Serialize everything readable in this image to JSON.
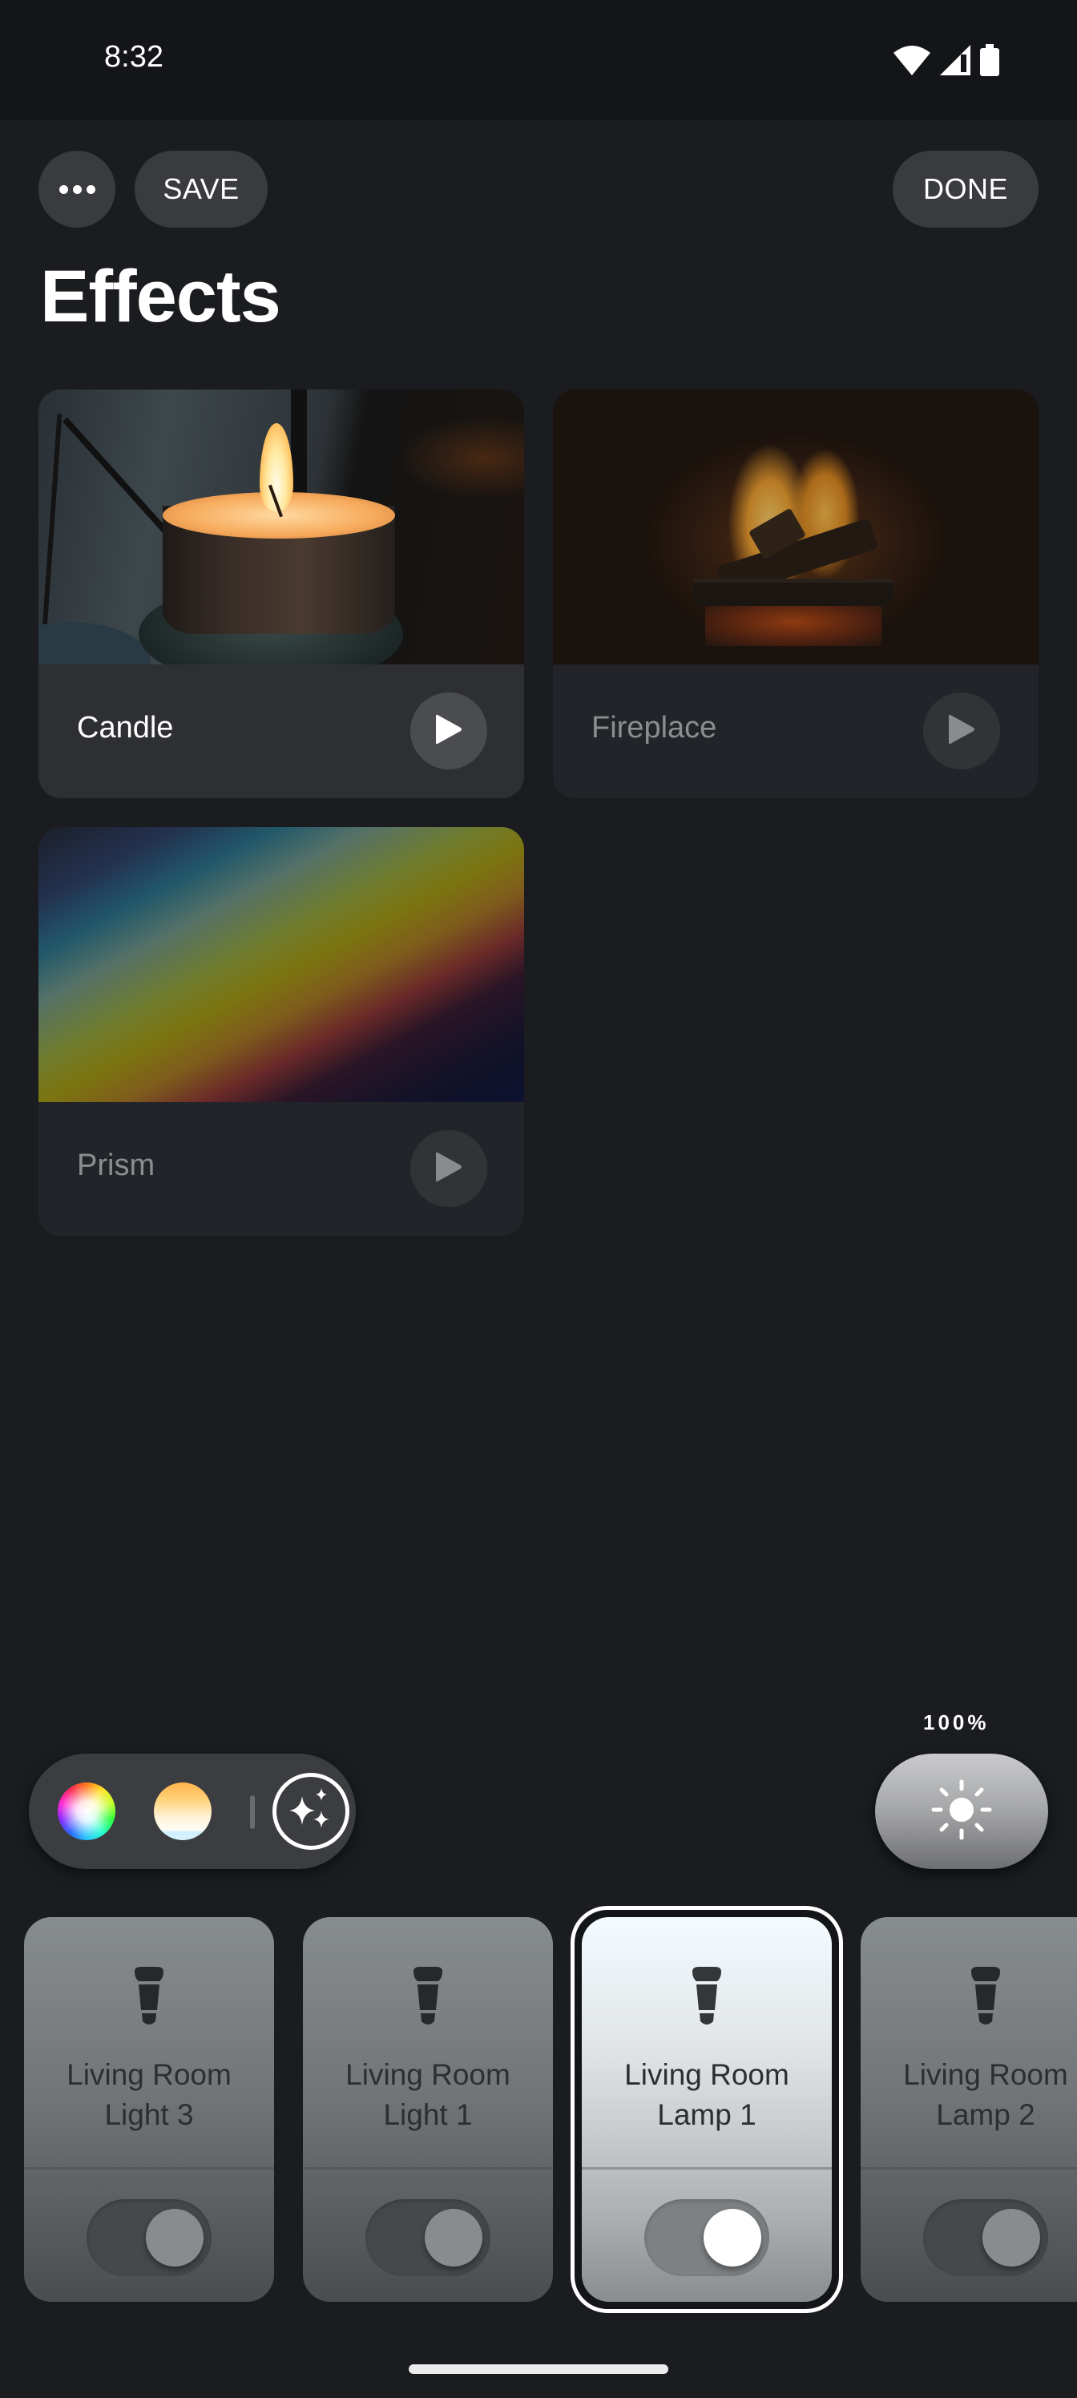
{
  "status_bar": {
    "time": "8:32",
    "icons": [
      "wifi-icon",
      "cell-signal-icon",
      "battery-icon"
    ]
  },
  "header": {
    "more_icon": "more-horizontal-icon",
    "save_label": "SAVE",
    "done_label": "DONE",
    "title": "Effects"
  },
  "effects": [
    {
      "name": "Candle",
      "active": true,
      "icon": "play-icon"
    },
    {
      "name": "Fireplace",
      "active": false,
      "icon": "play-icon"
    },
    {
      "name": "Prism",
      "active": false,
      "icon": "play-icon"
    }
  ],
  "mode_selector": {
    "modes": [
      "color-wheel-icon",
      "white-temperature-icon",
      "effects-sparkle-icon"
    ],
    "selected": "effects-sparkle-icon"
  },
  "brightness": {
    "label": "100%",
    "value_percent": 100,
    "icon": "sun-icon"
  },
  "lights": [
    {
      "name": "Living Room\nLight 3",
      "on": true,
      "selected": false
    },
    {
      "name": "Living Room\nLight 1",
      "on": true,
      "selected": false
    },
    {
      "name": "Living Room\nLamp 1",
      "on": true,
      "selected": true
    },
    {
      "name": "Living Room\nLamp 2",
      "on": true,
      "selected": false
    }
  ],
  "colors": {
    "background": "#1a1c20",
    "status_bar": "#141518",
    "button_bg": "#3a3b3f",
    "card_active_footer": "#2e2f33",
    "card_inactive_footer": "#222429",
    "inactive_text": "#8c8d90"
  }
}
